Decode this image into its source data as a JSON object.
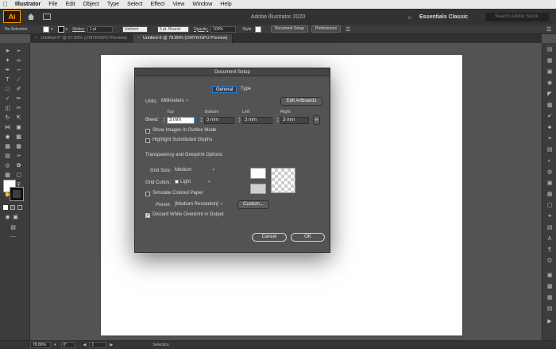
{
  "menubar": {
    "app_name": "Illustrator",
    "items": [
      "File",
      "Edit",
      "Object",
      "Type",
      "Select",
      "Effect",
      "View",
      "Window",
      "Help"
    ]
  },
  "appbar": {
    "logo": "Ai",
    "title": "Adobe Illustrator 2020",
    "workspace": "Essentials Classic",
    "search_placeholder": "Search Adobe Stock"
  },
  "controlbar": {
    "selection": "No Selection",
    "stroke_label": "Stroke:",
    "stroke_value": "1 pt",
    "uniform": "Uniform",
    "brush": "5 pt. Round",
    "opacity_label": "Opacity:",
    "opacity_value": "100%",
    "style_label": "Style:",
    "doc_setup_button": "Document Setup",
    "preferences_button": "Preferences"
  },
  "tabs": [
    {
      "label": "Untitled-5* @ 57.89% (CMYK/GPU Preview)",
      "active": false
    },
    {
      "label": "Untitled-6 @ 78.89% (CMYK/GPU Preview)",
      "active": true
    }
  ],
  "statusbar": {
    "zoom": "78.89%",
    "rotation": "0°",
    "artboard": "1",
    "mode": "Selection"
  },
  "dialog": {
    "title": "Document Setup",
    "tabs": [
      "General",
      "Type"
    ],
    "units_label": "Units:",
    "units_value": "Millimeters",
    "edit_artboards": "Edit Artboards",
    "bleed_label": "Bleed:",
    "bleed_headers": [
      "Top",
      "Bottom",
      "Left",
      "Right"
    ],
    "bleed_values": [
      "3 mm",
      "3 mm",
      "3 mm",
      "3 mm"
    ],
    "show_images_outline": "Show Images In Outline Mode",
    "highlight_glyphs": "Highlight Substituted Glyphs",
    "section_title": "Transparency and Overprint Options",
    "grid_size_label": "Grid Size:",
    "grid_size_value": "Medium",
    "grid_colors_label": "Grid Colors:",
    "grid_colors_value": "Light",
    "simulate_paper": "Simulate Colored Paper",
    "preset_label": "Preset:",
    "preset_value": "[Medium Resolution]",
    "custom_button": "Custom...",
    "discard_white": "Discard White Overprint in Output",
    "discard_white_checked": true,
    "cancel_button": "Cancel",
    "ok_button": "OK"
  },
  "colors": {
    "accent": "#3b8ff0",
    "brand": "#ff9a00",
    "ui_dark": "#323232",
    "canvas": "#535353"
  }
}
